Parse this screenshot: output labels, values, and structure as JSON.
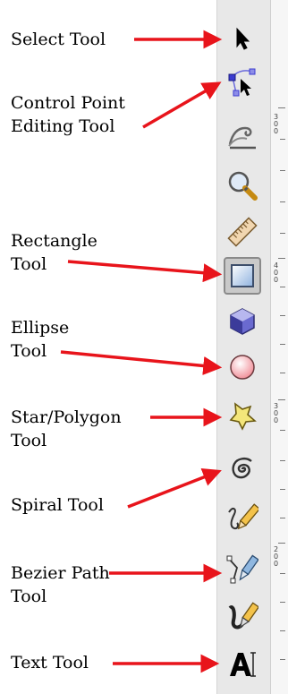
{
  "labels": {
    "select": "Select Tool",
    "control_point_1": "Control Point",
    "control_point_2": "Editing Tool",
    "rectangle_1": "Rectangle",
    "rectangle_2": "Tool",
    "ellipse_1": "Ellipse",
    "ellipse_2": "Tool",
    "star_1": "Star/Polygon",
    "star_2": "Tool",
    "spiral": "Spiral Tool",
    "bezier_1": "Bezier Path",
    "bezier_2": "Tool",
    "text": "Text Tool"
  },
  "ruler": {
    "n1": "300",
    "n2": "400",
    "n3": "300",
    "n4": "200"
  },
  "colors": {
    "arrow": "#e8141b",
    "toolbar_bg": "#e8e8e8"
  }
}
